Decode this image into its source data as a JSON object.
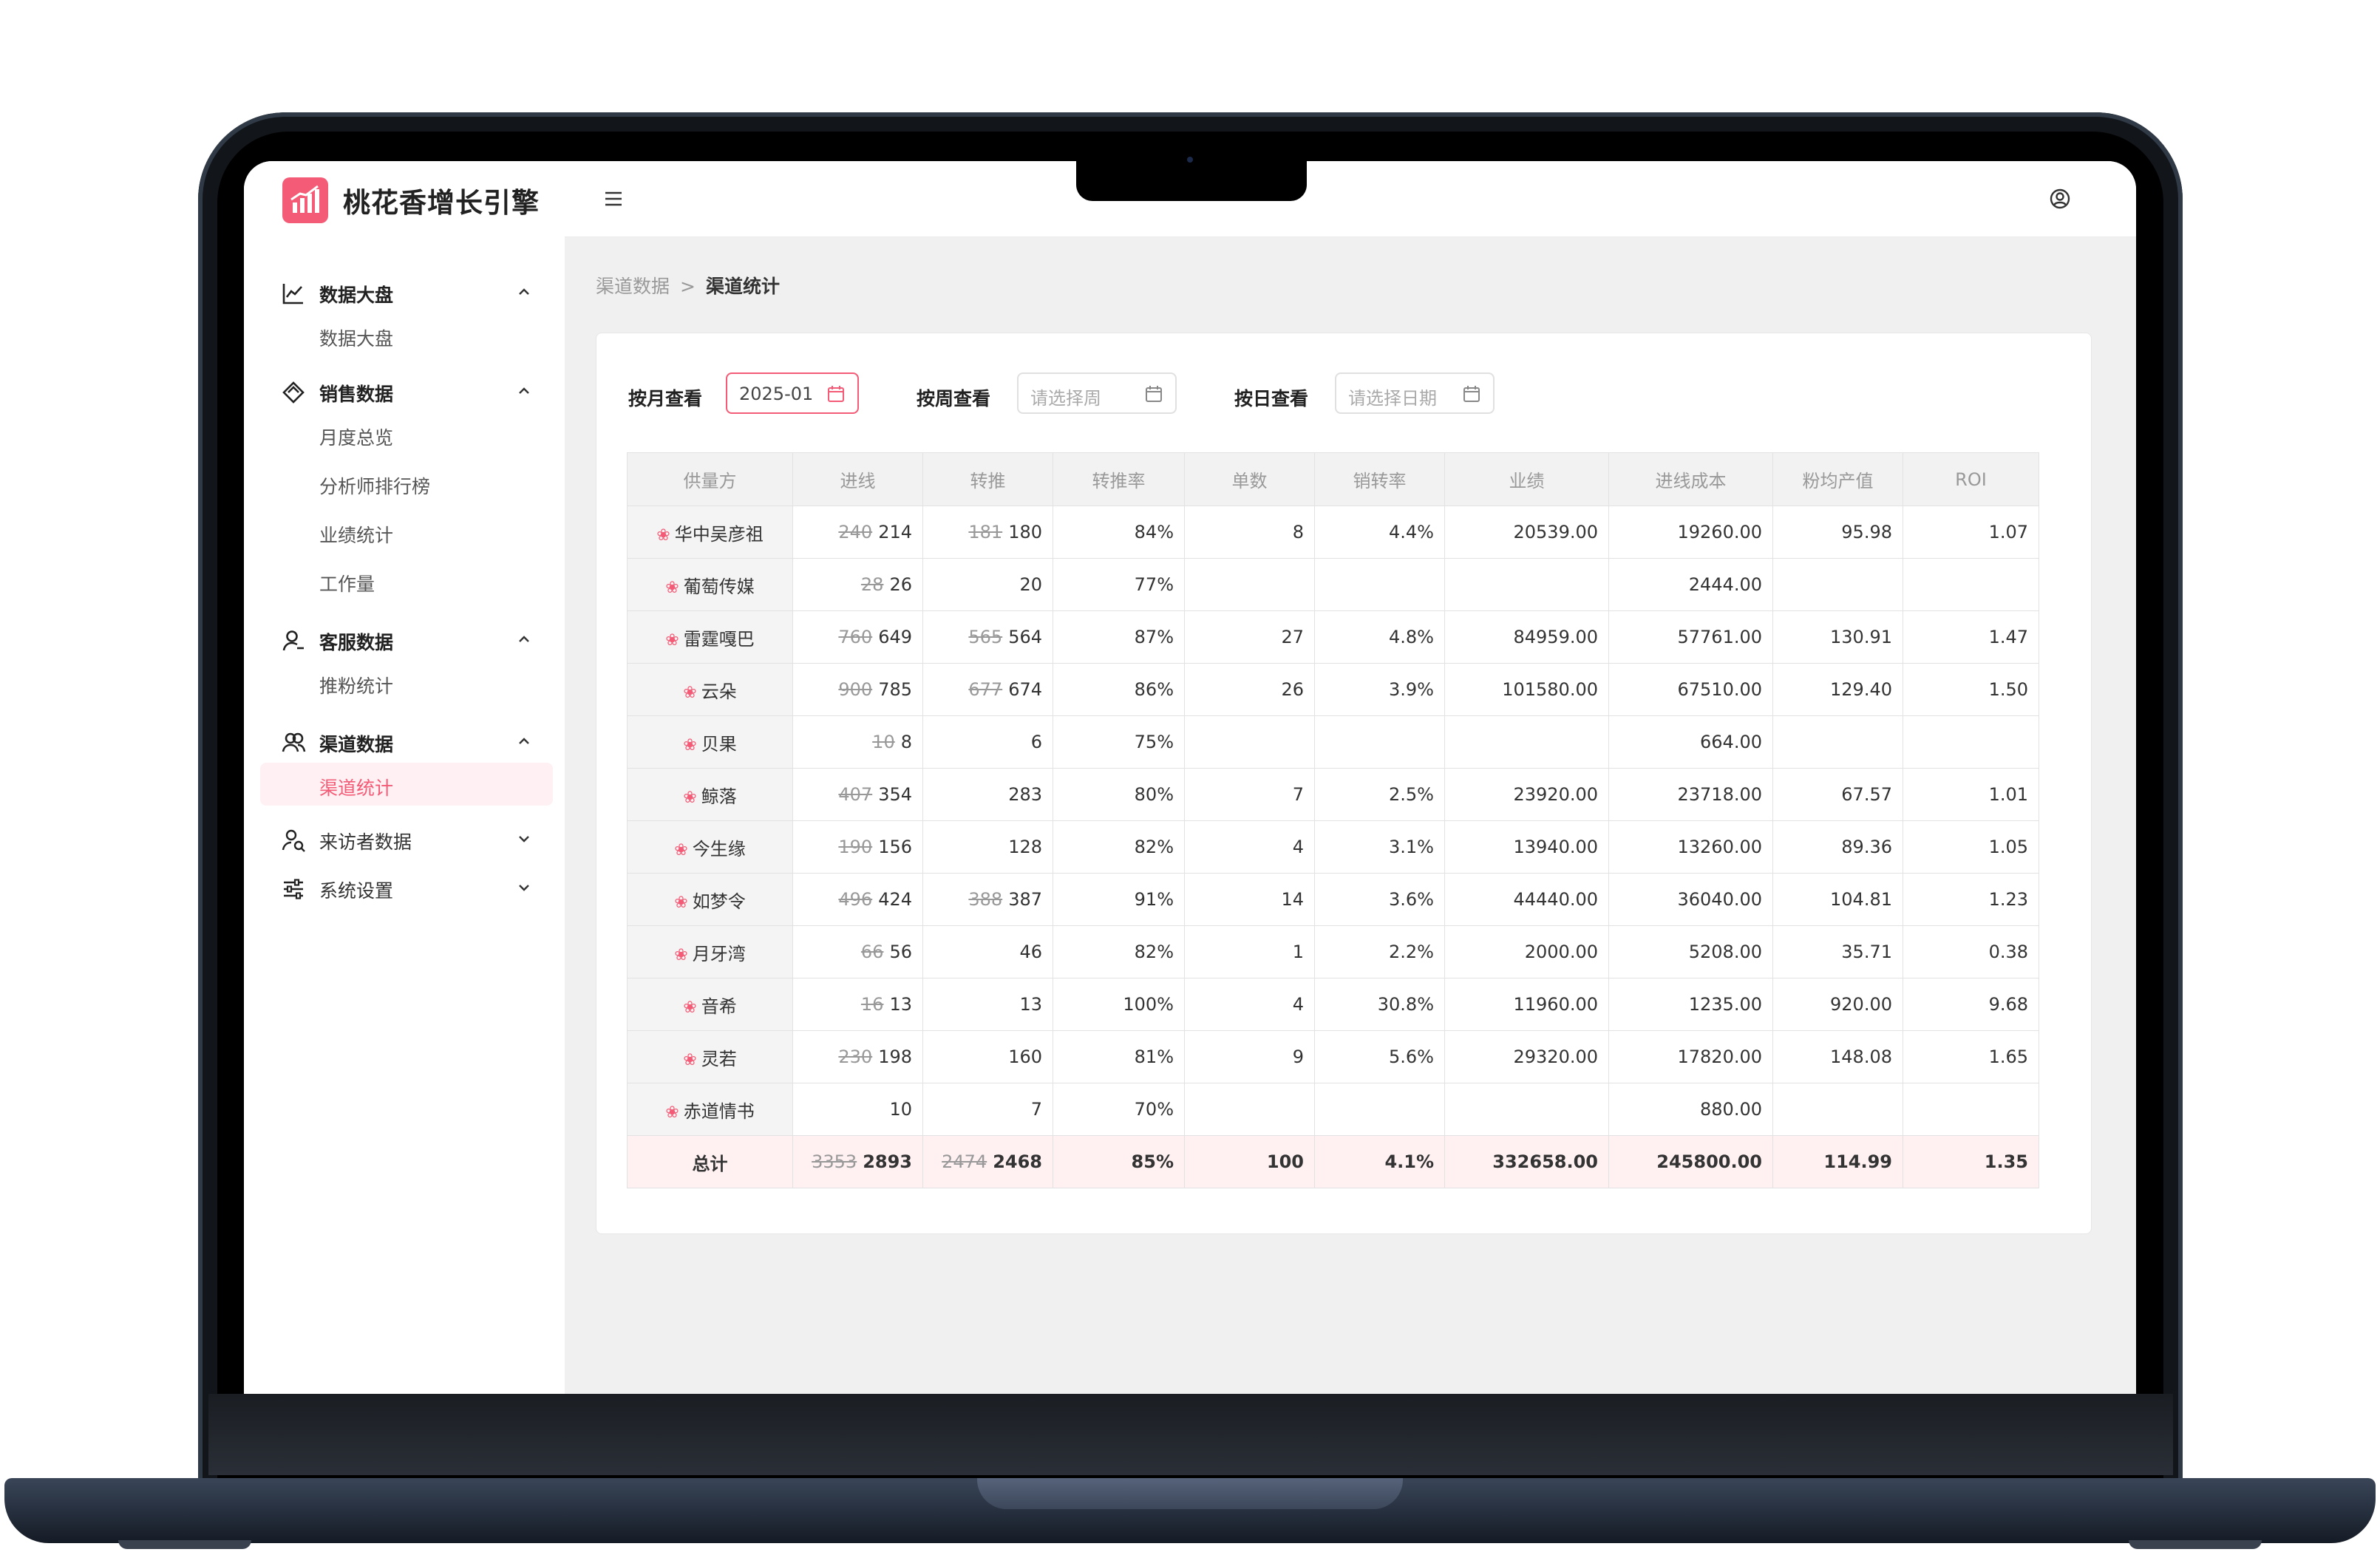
{
  "app": {
    "title": "桃花香增长引擎"
  },
  "sidebar": {
    "groups": [
      {
        "label": "数据大盘",
        "items": [
          "数据大盘"
        ]
      },
      {
        "label": "销售数据",
        "items": [
          "月度总览",
          "分析师排行榜",
          "业绩统计",
          "工作量"
        ]
      },
      {
        "label": "客服数据",
        "items": [
          "推粉统计"
        ]
      },
      {
        "label": "渠道数据",
        "items": [
          "渠道统计"
        ]
      },
      {
        "label": "来访者数据",
        "items": []
      },
      {
        "label": "系统设置",
        "items": []
      }
    ],
    "active_item": "渠道统计"
  },
  "breadcrumb": {
    "parent": "渠道数据",
    "separator": ">",
    "current": "渠道统计"
  },
  "filters": {
    "month": {
      "label": "按月查看",
      "value": "2025-01"
    },
    "week": {
      "label": "按周查看",
      "placeholder": "请选择周"
    },
    "day": {
      "label": "按日查看",
      "placeholder": "请选择日期"
    }
  },
  "table": {
    "headers": [
      "供量方",
      "进线",
      "转推",
      "转推率",
      "单数",
      "销转率",
      "业绩",
      "进线成本",
      "粉均产值",
      "ROI"
    ],
    "rows": [
      {
        "supplier": "华中吴彦祖",
        "in_old": "240",
        "in": "214",
        "push_old": "181",
        "push": "180",
        "push_rate": "84%",
        "orders": "8",
        "conv": "4.4%",
        "revenue": "20539.00",
        "cost": "19260.00",
        "avg": "95.98",
        "roi": "1.07"
      },
      {
        "supplier": "葡萄传媒",
        "in_old": "28",
        "in": "26",
        "push_old": "",
        "push": "20",
        "push_rate": "77%",
        "orders": "",
        "conv": "",
        "revenue": "",
        "cost": "2444.00",
        "avg": "",
        "roi": ""
      },
      {
        "supplier": "雷霆嘎巴",
        "in_old": "760",
        "in": "649",
        "push_old": "565",
        "push": "564",
        "push_rate": "87%",
        "orders": "27",
        "conv": "4.8%",
        "revenue": "84959.00",
        "cost": "57761.00",
        "avg": "130.91",
        "roi": "1.47"
      },
      {
        "supplier": "云朵",
        "in_old": "900",
        "in": "785",
        "push_old": "677",
        "push": "674",
        "push_rate": "86%",
        "orders": "26",
        "conv": "3.9%",
        "revenue": "101580.00",
        "cost": "67510.00",
        "avg": "129.40",
        "roi": "1.50"
      },
      {
        "supplier": "贝果",
        "in_old": "10",
        "in": "8",
        "push_old": "",
        "push": "6",
        "push_rate": "75%",
        "orders": "",
        "conv": "",
        "revenue": "",
        "cost": "664.00",
        "avg": "",
        "roi": ""
      },
      {
        "supplier": "鲸落",
        "in_old": "407",
        "in": "354",
        "push_old": "",
        "push": "283",
        "push_rate": "80%",
        "orders": "7",
        "conv": "2.5%",
        "revenue": "23920.00",
        "cost": "23718.00",
        "avg": "67.57",
        "roi": "1.01"
      },
      {
        "supplier": "今生缘",
        "in_old": "190",
        "in": "156",
        "push_old": "",
        "push": "128",
        "push_rate": "82%",
        "orders": "4",
        "conv": "3.1%",
        "revenue": "13940.00",
        "cost": "13260.00",
        "avg": "89.36",
        "roi": "1.05"
      },
      {
        "supplier": "如梦令",
        "in_old": "496",
        "in": "424",
        "push_old": "388",
        "push": "387",
        "push_rate": "91%",
        "orders": "14",
        "conv": "3.6%",
        "revenue": "44440.00",
        "cost": "36040.00",
        "avg": "104.81",
        "roi": "1.23"
      },
      {
        "supplier": "月牙湾",
        "in_old": "66",
        "in": "56",
        "push_old": "",
        "push": "46",
        "push_rate": "82%",
        "orders": "1",
        "conv": "2.2%",
        "revenue": "2000.00",
        "cost": "5208.00",
        "avg": "35.71",
        "roi": "0.38"
      },
      {
        "supplier": "音希",
        "in_old": "16",
        "in": "13",
        "push_old": "",
        "push": "13",
        "push_rate": "100%",
        "orders": "4",
        "conv": "30.8%",
        "revenue": "11960.00",
        "cost": "1235.00",
        "avg": "920.00",
        "roi": "9.68"
      },
      {
        "supplier": "灵若",
        "in_old": "230",
        "in": "198",
        "push_old": "",
        "push": "160",
        "push_rate": "81%",
        "orders": "9",
        "conv": "5.6%",
        "revenue": "29320.00",
        "cost": "17820.00",
        "avg": "148.08",
        "roi": "1.65"
      },
      {
        "supplier": "赤道情书",
        "in_old": "",
        "in": "10",
        "push_old": "",
        "push": "7",
        "push_rate": "70%",
        "orders": "",
        "conv": "",
        "revenue": "",
        "cost": "880.00",
        "avg": "",
        "roi": ""
      }
    ],
    "total": {
      "label": "总计",
      "in_old": "3353",
      "in": "2893",
      "push_old": "2474",
      "push": "2468",
      "push_rate": "85%",
      "orders": "100",
      "conv": "4.1%",
      "revenue": "332658.00",
      "cost": "245800.00",
      "avg": "114.99",
      "roi": "1.35"
    }
  },
  "colors": {
    "accent": "#f35b76",
    "accent_bg": "#fff0f2"
  },
  "icons": {
    "logo": "chart-logo-icon",
    "menu": "hamburger-icon",
    "user": "user-circle-icon",
    "calendar": "calendar-icon",
    "row": "flower-icon"
  }
}
